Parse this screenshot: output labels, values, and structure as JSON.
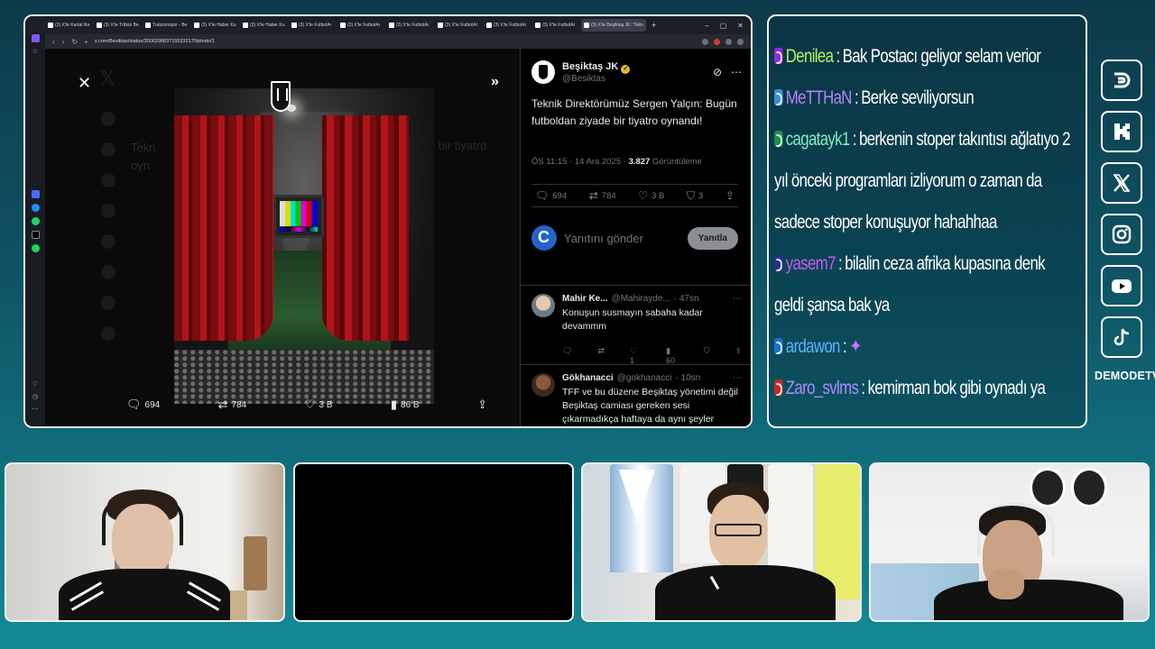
{
  "browser": {
    "tabs": [
      {
        "label": "(3) X'te Kartal Ra"
      },
      {
        "label": "(3) X'te Tribün Be"
      },
      {
        "label": "Trabzonspor - Be"
      },
      {
        "label": "(3) X'te Haber Ku"
      },
      {
        "label": "(3) X'te Haber Ku"
      },
      {
        "label": "(3) X'te FutbolAr"
      },
      {
        "label": "(3) X'te FutbolAr"
      },
      {
        "label": "(3) X'te FutbolAr"
      },
      {
        "label": "(3) X'te FutbolAr"
      },
      {
        "label": "(3) X'te FutbolAr"
      },
      {
        "label": "(3) X'te FutbolAr"
      },
      {
        "label": "(3) X'te Beşiktaş JK: 'Tekn"
      }
    ],
    "url": "x.com/Besiktas/status/2000298837155332170/photo/1"
  },
  "photo_viewer": {
    "ghost_text_line1": "Tekn",
    "ghost_text_line2": "oyn",
    "ghost_text_right": "yade bir tiyatro",
    "actions": {
      "replies": "694",
      "reposts": "784",
      "likes": "3 B",
      "views": "86 B"
    }
  },
  "tweet": {
    "author_name": "Beşiktaş JK",
    "author_handle": "@Besiktas",
    "text": "Teknik Direktörümüz Sergen Yalçın: Bugün futboldan ziyade bir tiyatro oynandı!",
    "time_date": "ÖS 11:15 · 14 Ara 2025 · ",
    "views_count": "3.827",
    "views_label": "Görüntüleme",
    "stats": {
      "replies": "694",
      "reposts": "784",
      "likes": "3 B",
      "bookmarks": "3"
    },
    "reply_placeholder": "Yanıtını gönder",
    "reply_button": "Yanıtla"
  },
  "replies": [
    {
      "name": "Mahir Ke...",
      "handle": "@Mahirayde...",
      "time": "· 47sn",
      "text": "Konuşun susmayın sabaha kadar devammm",
      "likes": "1",
      "views": "60"
    },
    {
      "name": "Gökhanacci",
      "handle": "@gokhanacci",
      "time": "· 10sn",
      "text": "TFF ve bu düzene Beşiktaş yönetimi değil Beşiktaş camiası gereken sesi çıkarmadıkça haftaya da aynı şeyler yaşanmaya devam eder"
    }
  ],
  "chat": {
    "messages": [
      {
        "user": "Denilea",
        "text": "Bak Postacı geliyor selam verior",
        "color": "#b6f06a",
        "badge": "#8a2be2"
      },
      {
        "user": "MeTTHaN",
        "text": "Berke seviliyorsun",
        "color": "#b784ff",
        "badge": "#3a8fd6"
      },
      {
        "user": "cagatayk1",
        "text": "berkenin stoper takıntısı ağlatıyo 2 yıl önceki programları izliyorum o zaman da sadece stoper konuşuyor hahahhaa",
        "color": "#7ff0c2",
        "badge": "#1c8f4a"
      },
      {
        "user": "yasem7",
        "text": "bilalin ceza afrika kupasına denk geldi şansa bak ya",
        "color": "#c45cf2",
        "badge": "#2a2f8f"
      },
      {
        "user": "ardawon",
        "text": "",
        "color": "#57b6ff",
        "badge": "#1a6fd0"
      },
      {
        "user": "Zaro_svlms",
        "text": "kemirman bok gibi oynadı ya",
        "color": "#a98cff",
        "badge": "#c22a2a"
      }
    ]
  },
  "socials": {
    "items": [
      "demode-icon",
      "kick-icon",
      "x-icon",
      "instagram-icon",
      "youtube-icon",
      "tiktok-icon"
    ],
    "brand": "DEMODETV"
  }
}
